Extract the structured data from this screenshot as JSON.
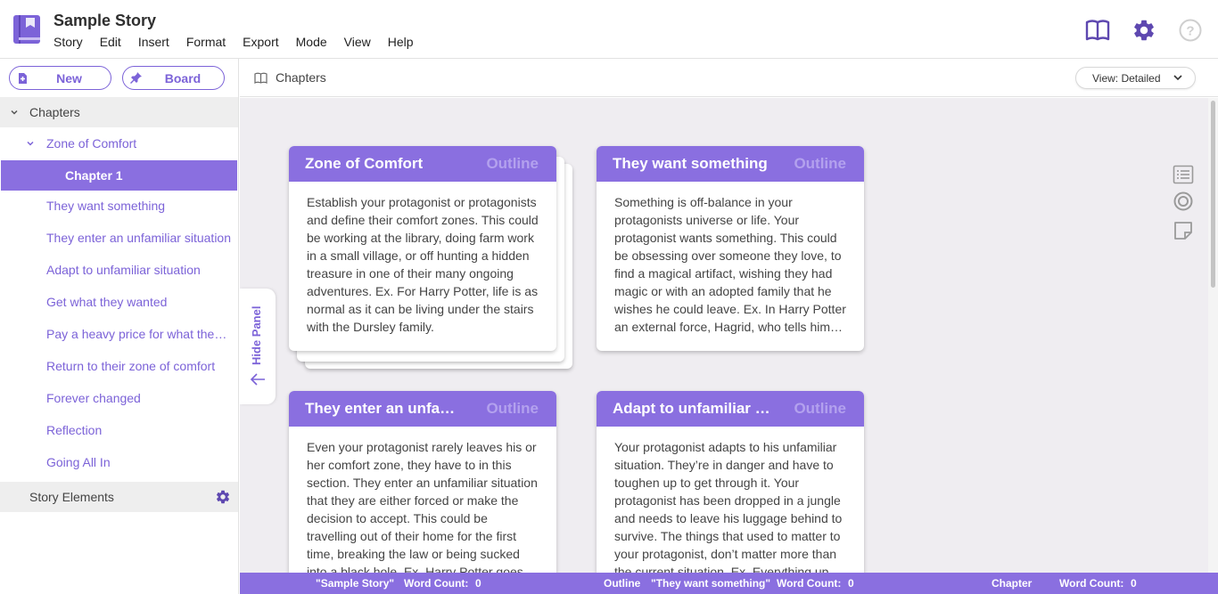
{
  "app": {
    "title": "Sample Story",
    "menu": [
      "Story",
      "Edit",
      "Insert",
      "Format",
      "Export",
      "Mode",
      "View",
      "Help"
    ],
    "brand_color": "#8a6fe0"
  },
  "toolbar_icons": [
    "book-icon",
    "gear-icon",
    "help-icon"
  ],
  "sidebar": {
    "new_label": "New",
    "board_label": "Board",
    "section_label": "Chapters",
    "group_label": "Zone of Comfort",
    "active_item": "Chapter 1",
    "items": [
      "They want something",
      "They enter an unfamiliar situation",
      "Adapt to unfamiliar situation",
      "Get what they wanted",
      "Pay a heavy price for what they wanted",
      "Return to their zone of comfort",
      "Forever changed",
      "Reflection",
      "Going All In"
    ],
    "story_elements_label": "Story Elements"
  },
  "content": {
    "breadcrumb": "Chapters",
    "view_select": "View: Detailed",
    "hide_panel_label": "Hide Panel"
  },
  "cards": [
    {
      "title": "Zone of Comfort",
      "type": "Outline",
      "body": "Establish your protagonist or protagonists and define their comfort zones. This could be working at the library, doing farm work in a small village, or off hunting a hidden treasure in one of their many ongoing adventures. Ex. For Harry Potter, life is as normal as it can be living under the stairs with the Dursley family."
    },
    {
      "title": "They want something",
      "type": "Outline",
      "body": "Something is off-balance in your protagonists universe or life. Your protagonist wants something. This could be obsessing over someone they love, to find a magical artifact, wishing they had magic or with an adopted family that he wishes he could leave. Ex. In Harry Potter an external force, Hagrid, who tells him he is a wizard."
    },
    {
      "title": "They enter an unfamiliar situation",
      "type": "Outline",
      "body": "Even your protagonist rarely leaves his or her comfort zone, they have to in this section. They enter an unfamiliar situation that they are either forced or make the decision to accept. This could be travelling out of their home for the first time, breaking the law or being sucked into a black hole. Ex. Harry Potter goes to Hogwarts."
    },
    {
      "title": "Adapt to unfamiliar situation",
      "type": "Outline",
      "body": "Your protagonist adapts to his unfamiliar situation. They’re in danger and have to toughen up to get through it. Your protagonist has been dropped in a jungle and needs to leave his luggage behind to survive. The things that used to matter to your protagonist, don’t matter more than the current situation. Ex. Everything up to the final battle."
    }
  ],
  "status": {
    "story_name": "\"Sample Story\"",
    "word_count_label": "Word Count:",
    "story_word_count": "0",
    "selected_type": "Outline",
    "selected_name": "\"They want something\"",
    "selected_word_count": "0",
    "chapter_label": "Chapter",
    "chapter_word_count": "0"
  }
}
